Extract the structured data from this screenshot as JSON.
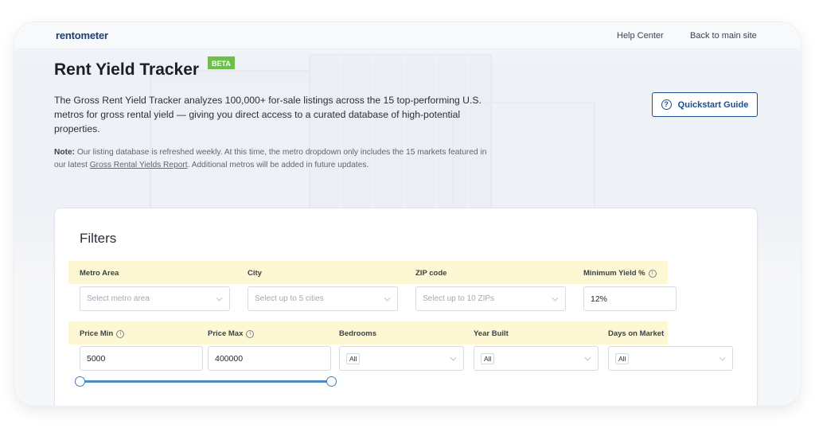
{
  "header": {
    "logo": "rentometer",
    "nav": [
      "Help Center",
      "Back to main site"
    ]
  },
  "hero": {
    "title": "Rent Yield Tracker",
    "badge": "BETA",
    "description": "The Gross Rent Yield Tracker analyzes 100,000+ for-sale listings across the 15 top-performing U.S. metros for gross rental yield — giving you direct access to a curated database of high-potential properties.",
    "note_label": "Note:",
    "note_text_1": " Our listing database is refreshed weekly. At this time, the metro dropdown only includes the 15 markets featured in our latest ",
    "note_link": "Gross Rental Yields Report",
    "note_text_2": ". Additional metros will be added in future updates.",
    "quickstart_label": "Quickstart Guide",
    "quickstart_icon": "question-circle-icon"
  },
  "filters": {
    "title": "Filters",
    "metro_area": {
      "label": "Metro Area",
      "placeholder": "Select metro area"
    },
    "city": {
      "label": "City",
      "placeholder": "Select up to 5 cities"
    },
    "zip": {
      "label": "ZIP code",
      "placeholder": "Select up to 10 ZIPs"
    },
    "min_yield": {
      "label": "Minimum Yield %",
      "value": "12%"
    },
    "price_min": {
      "label": "Price Min",
      "value": "5000"
    },
    "price_max": {
      "label": "Price Max",
      "value": "400000"
    },
    "bedrooms": {
      "label": "Bedrooms",
      "value": "All"
    },
    "year_built": {
      "label": "Year Built",
      "value": "All"
    },
    "days_on_market": {
      "label": "Days on Market",
      "value": "All"
    },
    "price_range_slider": {
      "low_fraction": 0.0,
      "high_fraction": 1.0
    }
  },
  "colors": {
    "brand": "#1f3d74",
    "accent": "#1e4d8f",
    "beta_badge": "#6cbf4a",
    "highlight": "#fdf8d3",
    "slider": "#4d8ac9"
  }
}
